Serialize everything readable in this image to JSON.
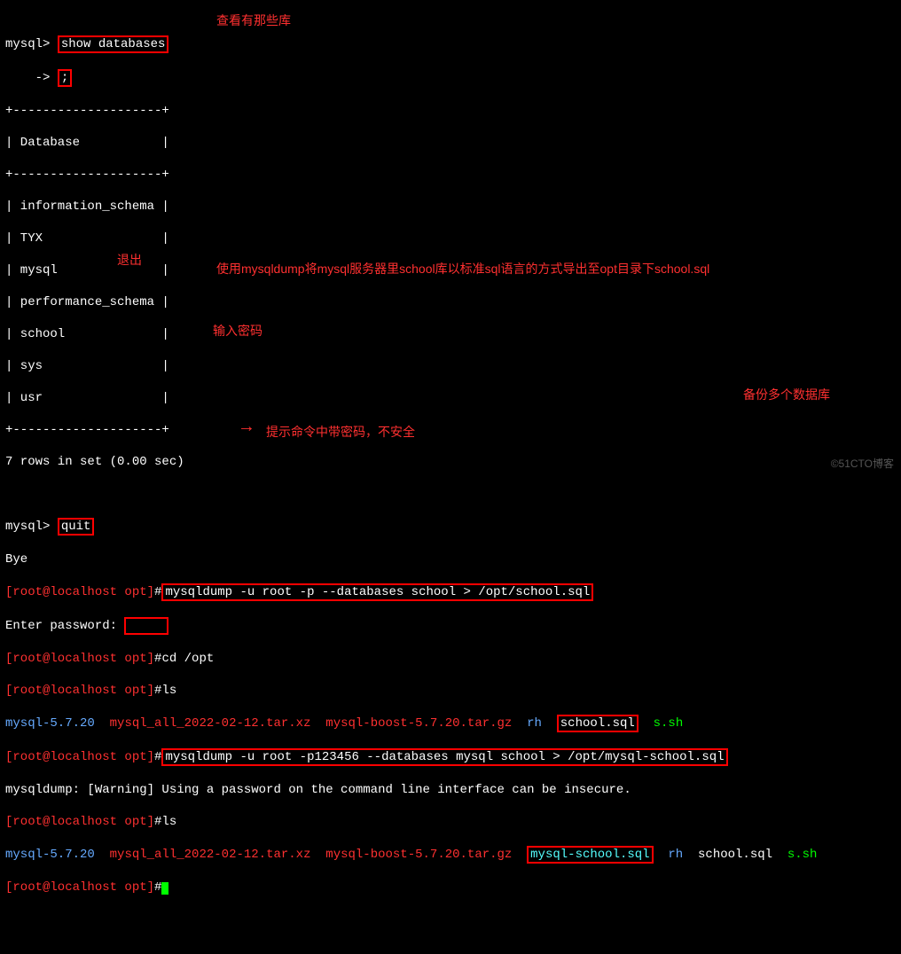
{
  "annotations": {
    "a1": "查看有那些库",
    "a2": "退出",
    "a3": "使用mysqldump将mysql服务器里school库以标准sql语言的方式导出至opt目录下school.sql",
    "a4": "输入密码",
    "a5": "提示命令中带密码，不安全",
    "a6": "备份多个数据库"
  },
  "t": {
    "p1a": "mysql> ",
    "p1b": "show databases",
    "p2a": "    -> ",
    "p2b": ";",
    "sep": "+--------------------+",
    "hdr": "| Database           |",
    "d1": "| information_schema |",
    "d2": "| TYX                |",
    "d3": "| mysql              |",
    "d4": "| performance_schema |",
    "d5": "| school             |",
    "d6": "| sys                |",
    "d7": "| usr                |",
    "rows": "7 rows in set (0.00 sec)",
    "p3a": "mysql> ",
    "p3b": "quit",
    "bye": "Bye",
    "rp": "[root@localhost opt]",
    "hash": "#",
    "cmd1": "mysqldump -u root -p --databases school > /opt/school.sql",
    "ep": "Enter password: ",
    "cmd2": "cd /opt",
    "cmd3": "ls",
    "ls1a": "mysql-5.7.20",
    "ls1b": "mysql_all_2022-02-12.tar.xz",
    "ls1c": "mysql-boost-5.7.20.tar.gz",
    "ls1d": "rh",
    "ls1e": "school.sql",
    "ls1f": "s.sh",
    "cmd4": "mysqldump -u root -p123456 --databases mysql school > /opt/mysql-school.sql",
    "warn": "mysqldump: [Warning] Using a password on the command line interface can be insecure.",
    "ls2a": "mysql-5.7.20",
    "ls2b": "mysql_all_2022-02-12.tar.xz",
    "ls2c": "mysql-boost-5.7.20.tar.gz",
    "ls2d": "mysql-school.sql",
    "ls2e": "rh",
    "ls2f": "school.sql",
    "ls2g": "s.sh"
  },
  "watermark": "©51CTO博客"
}
